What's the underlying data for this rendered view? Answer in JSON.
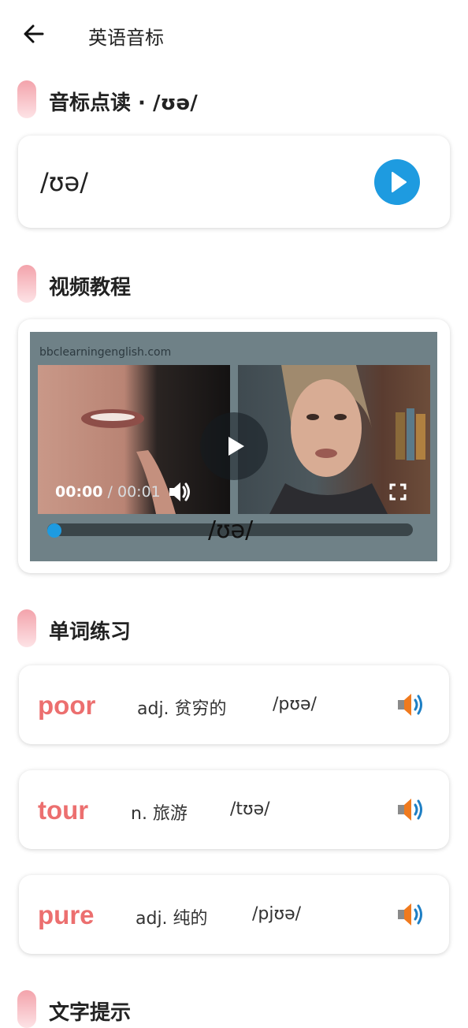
{
  "header": {
    "title": "英语音标",
    "back_icon": "arrow-left-icon"
  },
  "section_symbol": {
    "title": "音标点读 · /ʊə/",
    "symbol": "/ʊə/"
  },
  "section_video": {
    "title": "视频教程",
    "watermark": "bbclearningenglish.com",
    "current_time": "00:00",
    "separator": "/",
    "duration": "00:01",
    "caption": "/ʊə/",
    "progress": 0.0
  },
  "section_words": {
    "title": "单词练习",
    "items": [
      {
        "word": "poor",
        "definition": "adj. 贫穷的",
        "phonetic": "/pʊə/"
      },
      {
        "word": "tour",
        "definition": "n. 旅游",
        "phonetic": "/tʊə/"
      },
      {
        "word": "pure",
        "definition": "adj. 纯的",
        "phonetic": "/pjʊə/"
      }
    ]
  },
  "section_tips": {
    "title": "文字提示"
  },
  "colors": {
    "accent_blue": "#1e9be0",
    "word_red": "#ec6f6f",
    "section_bar": "#f3a3ab"
  }
}
